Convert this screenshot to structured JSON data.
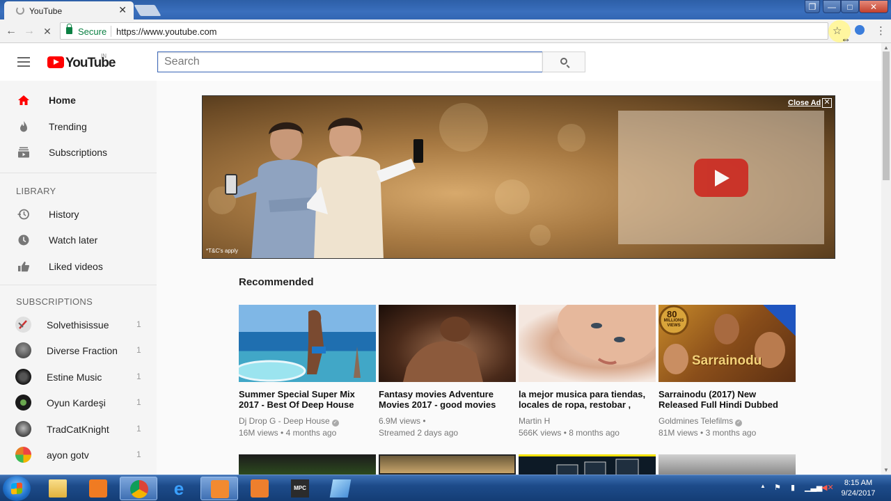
{
  "browser": {
    "tab_title": "YouTube",
    "tab_close": "✕",
    "secure_label": "Secure",
    "url": "https://www.youtube.com",
    "window_buttons": {
      "restore": "❐",
      "minimize": "—",
      "maximize": "□",
      "close": "✕"
    },
    "back_icon": "←",
    "forward_icon": "→",
    "stop_icon": "✕",
    "star_icon": "☆",
    "menu_icon": "⋮"
  },
  "youtube": {
    "logo_text": "YouTube",
    "country": "IN",
    "search": {
      "placeholder": "Search"
    },
    "guide": {
      "main": [
        {
          "label": "Home",
          "icon": "home-icon",
          "active": true
        },
        {
          "label": "Trending",
          "icon": "flame-icon"
        },
        {
          "label": "Subscriptions",
          "icon": "subscriptions-icon"
        }
      ],
      "library_heading": "LIBRARY",
      "library": [
        {
          "label": "History",
          "icon": "history-icon"
        },
        {
          "label": "Watch later",
          "icon": "clock-icon"
        },
        {
          "label": "Liked videos",
          "icon": "thumbs-up-icon"
        }
      ],
      "subscriptions_heading": "SUBSCRIPTIONS",
      "subscriptions": [
        {
          "label": "Solvethisissue",
          "count": "1",
          "color": "#c9c9c9"
        },
        {
          "label": "Diverse Fraction",
          "count": "1",
          "color": "#555555"
        },
        {
          "label": "Estine Music",
          "count": "1",
          "color": "#222222"
        },
        {
          "label": "Oyun Kardeşi",
          "count": "1",
          "color": "#2a2a2a"
        },
        {
          "label": "TradCatKnight",
          "count": "1",
          "color": "#666666"
        },
        {
          "label": "ayon gotv",
          "count": "1",
          "color": "#d9861d"
        }
      ]
    },
    "ad": {
      "close_label": "Close Ad",
      "close_icon": "✕",
      "terms": "*T&C's apply"
    },
    "recommended": {
      "heading": "Recommended",
      "videos": [
        {
          "title": "Summer Special Super Mix 2017 - Best Of Deep House",
          "channel": "Dj Drop G - Deep House",
          "verified": true,
          "views": "16M views",
          "age": "4 months ago"
        },
        {
          "title": "Fantasy movies Adventure Movies 2017 - good movies",
          "channel": "6.9M views •",
          "verified": false,
          "views": "Streamed 2 days ago",
          "age": ""
        },
        {
          "title": "la mejor musica para tiendas, locales de ropa, restobar ,",
          "channel": "Martin H",
          "verified": false,
          "views": "566K views",
          "age": "8 months ago"
        },
        {
          "title": "Sarrainodu (2017) New Released Full Hindi Dubbed",
          "channel": "Goldmines Telefilms",
          "verified": true,
          "views": "81M views",
          "age": "3 months ago"
        }
      ]
    },
    "thumbnail_text": {
      "badge_number": "80",
      "badge_text": "MILLIONS VIEWS",
      "movie_title": "Sarrainodu"
    }
  },
  "taskbar": {
    "time": "8:15 AM",
    "date": "9/24/2017",
    "tray_arrow": "▲"
  }
}
